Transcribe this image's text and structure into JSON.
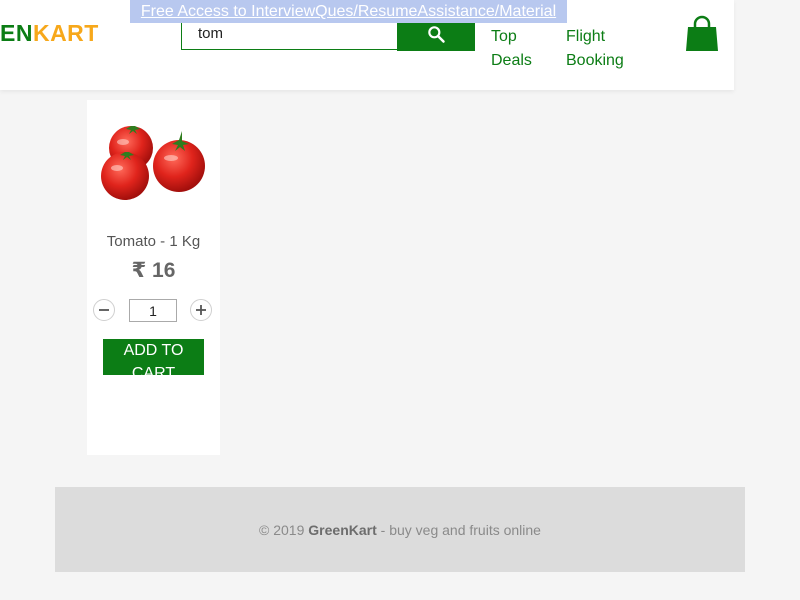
{
  "header": {
    "brand_prefix": "EN",
    "brand_suffix": "KART",
    "banner_link": "Free Access to InterviewQues/ResumeAssistance/Material",
    "search_value": "tom",
    "nav": {
      "top_deals": "Top Deals",
      "flight_booking": "Flight Booking"
    }
  },
  "product": {
    "name": "Tomato - 1 Kg",
    "price": "₹ 16",
    "quantity": "1",
    "add_to_cart": "ADD TO CART"
  },
  "footer": {
    "copyright": "© 2019",
    "brand": "GreenKart",
    "tagline": "- buy veg and fruits online"
  },
  "colors": {
    "primary_green": "#0c7d15",
    "brand_orange": "#f7a81b",
    "background": "#f5f5f5",
    "footer_bg": "#dcdcdc"
  },
  "icons": {
    "search": "search-icon",
    "cart": "shopping-bag-icon",
    "decrement": "minus-icon",
    "increment": "plus-icon"
  }
}
